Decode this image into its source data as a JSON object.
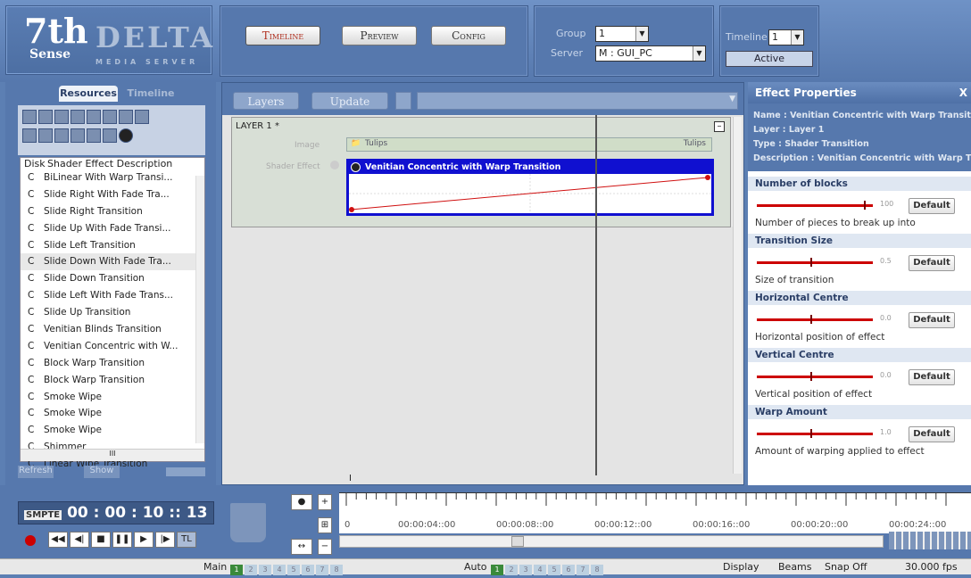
{
  "logo": {
    "num": "7th",
    "sense": "Sense",
    "delta": "DELTA",
    "media_server": "MEDIA SERVER"
  },
  "top_tabs": [
    {
      "label": "Timeline",
      "active": true
    },
    {
      "label": "Preview",
      "active": false
    },
    {
      "label": "Config",
      "active": false
    }
  ],
  "group": {
    "label": "Group",
    "value": "1"
  },
  "server": {
    "label": "Server",
    "value": "M : GUI_PC"
  },
  "timeline_sel": {
    "label": "Timeline",
    "value": "1",
    "status": "Active"
  },
  "left": {
    "tabs": [
      "Resources",
      "Timeline"
    ],
    "columns": [
      "Disk",
      "Shader Effect Description"
    ],
    "rows": [
      {
        "disk": "C",
        "desc": "BiLinear With Warp Transi..."
      },
      {
        "disk": "C",
        "desc": "Slide Right With Fade Tra..."
      },
      {
        "disk": "C",
        "desc": "Slide Right Transition"
      },
      {
        "disk": "C",
        "desc": "Slide Up With Fade Transi..."
      },
      {
        "disk": "C",
        "desc": "Slide Left Transition"
      },
      {
        "disk": "C",
        "desc": "Slide Down With Fade Tra..."
      },
      {
        "disk": "C",
        "desc": "Slide Down Transition"
      },
      {
        "disk": "C",
        "desc": "Slide Left With Fade Trans..."
      },
      {
        "disk": "C",
        "desc": "Slide Up Transition"
      },
      {
        "disk": "C",
        "desc": "Venitian Blinds Transition"
      },
      {
        "disk": "C",
        "desc": "Venitian Concentric with W..."
      },
      {
        "disk": "C",
        "desc": "Block Warp Transition"
      },
      {
        "disk": "C",
        "desc": "Block Warp Transition"
      },
      {
        "disk": "C",
        "desc": "Smoke Wipe"
      },
      {
        "disk": "C",
        "desc": "Smoke Wipe"
      },
      {
        "disk": "C",
        "desc": "Smoke Wipe"
      },
      {
        "disk": "C",
        "desc": "Shimmer"
      },
      {
        "disk": "C",
        "desc": "Linear Wipe Transition"
      }
    ],
    "scroll_mark": "III",
    "refresh": "Refresh",
    "show": "Show"
  },
  "center": {
    "layers_btn": "Layers",
    "update_btn": "Update",
    "layer_title": "LAYER 1 *",
    "image_label": "Image",
    "image_name": "Tulips",
    "image_name_right": "Tulips",
    "shader_label": "Shader Effect",
    "shader_name": "Venitian Concentric with Warp Transition",
    "cursor_mark": "I"
  },
  "props": {
    "title": "Effect Properties",
    "close": "X",
    "name": "Name : Venitian Concentric with Warp Transition",
    "layer": "Layer : Layer 1",
    "type": "Type : Shader Transition",
    "description": "Description : Venitian Concentric with Warp Transition",
    "params": [
      {
        "name": "Number of blocks",
        "value": "100",
        "level": 1.0,
        "default": "Default",
        "desc": "Number of pieces to break up into"
      },
      {
        "name": "Transition Size",
        "value": "0.5",
        "level": 0.5,
        "default": "Default",
        "desc": "Size of transition"
      },
      {
        "name": "Horizontal Centre",
        "value": "0.0",
        "level": 0.5,
        "default": "Default",
        "desc": "Horizontal position of effect"
      },
      {
        "name": "Vertical Centre",
        "value": "0.0",
        "level": 0.5,
        "default": "Default",
        "desc": "Vertical position of effect"
      },
      {
        "name": "Warp Amount",
        "value": "1.0",
        "level": 0.5,
        "default": "Default",
        "desc": "Amount of warping applied to effect"
      }
    ]
  },
  "transport": {
    "smpte": "SMPTE",
    "h": "00",
    "m": "00",
    "s": "10",
    "f": "13"
  },
  "ruler": {
    "ticks": [
      "0",
      "00:00:04::00",
      "00:00:08::00",
      "00:00:12::00",
      "00:00:16::00",
      "00:00:20::00",
      "00:00:24::00"
    ]
  },
  "status": {
    "main": "Main",
    "auto": "Auto",
    "nums": [
      "1",
      "2",
      "3",
      "4",
      "5",
      "6",
      "7",
      "8"
    ],
    "display": "Display",
    "beams": "Beams",
    "snap": "Snap Off",
    "fps": "30.000 fps"
  },
  "colors": {
    "accent_red": "#d01010",
    "shader_blue": "#1010d0",
    "panel_blue": "#5678ad"
  }
}
